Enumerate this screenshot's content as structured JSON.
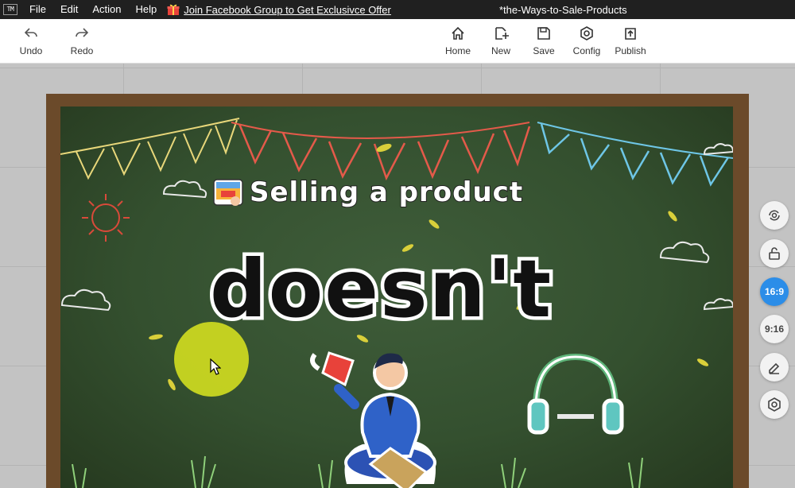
{
  "app": {
    "logo": "TM",
    "document_title": "*the-Ways-to-Sale-Products"
  },
  "menubar": {
    "items": [
      "File",
      "Edit",
      "Action",
      "Help"
    ],
    "promo_text": "Join Facebook Group to Get Exclusivce Offer"
  },
  "toolbar": {
    "undo": "Undo",
    "redo": "Redo",
    "home": "Home",
    "new": "New",
    "save": "Save",
    "config": "Config",
    "publish": "Publish"
  },
  "canvas": {
    "heading": "Selling a product",
    "big_word": "doesn't"
  },
  "side_panel": {
    "ratio_16_9": "16:9",
    "ratio_9_16": "9:16",
    "active_ratio": "16:9",
    "icons": [
      "refresh-icon",
      "unlock-icon",
      "eraser-icon",
      "settings-icon"
    ]
  },
  "colors": {
    "accent": "#2b8de8",
    "menubar": "#202020",
    "chalkboard": "#3f5d3a",
    "frame": "#6b4a2a",
    "cursor_highlight": "#dce61e"
  }
}
